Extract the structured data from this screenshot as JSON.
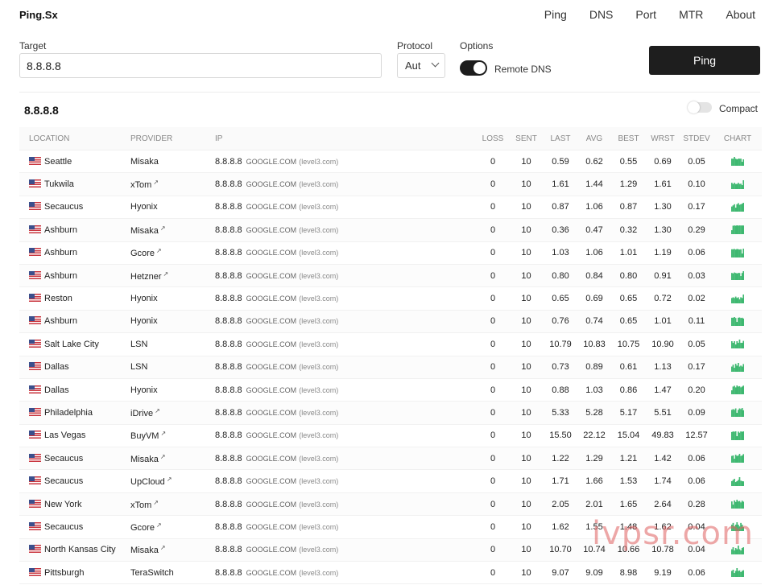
{
  "app": {
    "brand": "Ping.Sx"
  },
  "nav": [
    "Ping",
    "DNS",
    "Port",
    "MTR",
    "About"
  ],
  "form": {
    "target_label": "Target",
    "target_value": "8.8.8.8",
    "protocol_label": "Protocol",
    "protocol_value": "Aut",
    "options_label": "Options",
    "remote_dns_label": "Remote DNS",
    "remote_dns_enabled": true,
    "ping_button": "Ping"
  },
  "result": {
    "title": "8.8.8.8",
    "compact_label": "Compact",
    "compact_enabled": false
  },
  "table": {
    "headers": [
      "LOCATION",
      "PROVIDER",
      "IP",
      "LOSS",
      "SENT",
      "LAST",
      "AVG",
      "BEST",
      "WRST",
      "STDEV",
      "CHART"
    ],
    "rows": [
      {
        "location": "Seattle",
        "provider": "Misaka",
        "ext": false,
        "ip": "8.8.8.8",
        "host": "GOOGLE.COM",
        "sub": "(level3.com)",
        "loss": "0",
        "sent": "10",
        "last": "0.59",
        "avg": "0.62",
        "best": "0.55",
        "wrst": "0.69",
        "stdev": "0.05",
        "chart": [
          0.6,
          0.6,
          0.55,
          0.6,
          0.62,
          0.6,
          0.6,
          0.6,
          0.69,
          0.62
        ]
      },
      {
        "location": "Tukwila",
        "provider": "xTom",
        "ext": true,
        "ip": "8.8.8.8",
        "host": "GOOGLE.COM",
        "sub": "(level3.com)",
        "loss": "0",
        "sent": "10",
        "last": "1.61",
        "avg": "1.44",
        "best": "1.29",
        "wrst": "1.61",
        "stdev": "0.10",
        "chart": [
          1.4,
          1.45,
          1.4,
          1.45,
          1.45,
          1.4,
          1.45,
          1.44,
          1.5,
          1.29
        ]
      },
      {
        "location": "Secaucus",
        "provider": "Hyonix",
        "ext": false,
        "ip": "8.8.8.8",
        "host": "GOOGLE.COM",
        "sub": "(level3.com)",
        "loss": "0",
        "sent": "10",
        "last": "0.87",
        "avg": "1.06",
        "best": "0.87",
        "wrst": "1.30",
        "stdev": "0.17",
        "chart": [
          1.2,
          1.1,
          1.0,
          1.3,
          1.0,
          0.9,
          1.05,
          1.0,
          0.95,
          0.87
        ]
      },
      {
        "location": "Ashburn",
        "provider": "Misaka",
        "ext": true,
        "ip": "8.8.8.8",
        "host": "GOOGLE.COM",
        "sub": "(level3.com)",
        "loss": "0",
        "sent": "10",
        "last": "0.36",
        "avg": "0.47",
        "best": "0.32",
        "wrst": "1.30",
        "stdev": "0.29",
        "chart": [
          1.3,
          0.4,
          0.35,
          0.4,
          0.32,
          0.38,
          0.34,
          0.36,
          0.35,
          0.36
        ]
      },
      {
        "location": "Ashburn",
        "provider": "Gcore",
        "ext": true,
        "ip": "8.8.8.8",
        "host": "GOOGLE.COM",
        "sub": "(level3.com)",
        "loss": "0",
        "sent": "10",
        "last": "1.03",
        "avg": "1.06",
        "best": "1.01",
        "wrst": "1.19",
        "stdev": "0.06",
        "chart": [
          1.05,
          1.05,
          1.04,
          1.06,
          1.04,
          1.05,
          1.06,
          1.05,
          1.19,
          1.03
        ]
      },
      {
        "location": "Ashburn",
        "provider": "Hetzner",
        "ext": true,
        "ip": "8.8.8.8",
        "host": "GOOGLE.COM",
        "sub": "(level3.com)",
        "loss": "0",
        "sent": "10",
        "last": "0.80",
        "avg": "0.84",
        "best": "0.80",
        "wrst": "0.91",
        "stdev": "0.03",
        "chart": [
          0.84,
          0.85,
          0.83,
          0.84,
          0.85,
          0.84,
          0.84,
          0.91,
          0.84,
          0.8
        ]
      },
      {
        "location": "Reston",
        "provider": "Hyonix",
        "ext": false,
        "ip": "8.8.8.8",
        "host": "GOOGLE.COM",
        "sub": "(level3.com)",
        "loss": "0",
        "sent": "10",
        "last": "0.65",
        "avg": "0.69",
        "best": "0.65",
        "wrst": "0.72",
        "stdev": "0.02",
        "chart": [
          0.7,
          0.69,
          0.7,
          0.68,
          0.7,
          0.69,
          0.72,
          0.69,
          0.7,
          0.65
        ]
      },
      {
        "location": "Ashburn",
        "provider": "Hyonix",
        "ext": false,
        "ip": "8.8.8.8",
        "host": "GOOGLE.COM",
        "sub": "(level3.com)",
        "loss": "0",
        "sent": "10",
        "last": "0.76",
        "avg": "0.74",
        "best": "0.65",
        "wrst": "1.01",
        "stdev": "0.11",
        "chart": [
          0.7,
          0.7,
          0.65,
          0.72,
          1.01,
          0.7,
          0.68,
          0.72,
          0.7,
          0.76
        ]
      },
      {
        "location": "Salt Lake City",
        "provider": "LSN",
        "ext": false,
        "ip": "8.8.8.8",
        "host": "GOOGLE.COM",
        "sub": "(level3.com)",
        "loss": "0",
        "sent": "10",
        "last": "10.79",
        "avg": "10.83",
        "best": "10.75",
        "wrst": "10.90",
        "stdev": "0.05",
        "chart": [
          10.8,
          10.85,
          10.8,
          10.9,
          10.8,
          10.85,
          10.75,
          10.85,
          10.85,
          10.79
        ]
      },
      {
        "location": "Dallas",
        "provider": "LSN",
        "ext": false,
        "ip": "8.8.8.8",
        "host": "GOOGLE.COM",
        "sub": "(level3.com)",
        "loss": "0",
        "sent": "10",
        "last": "0.73",
        "avg": "0.89",
        "best": "0.61",
        "wrst": "1.13",
        "stdev": "0.17",
        "chart": [
          1.0,
          0.8,
          1.13,
          0.7,
          0.9,
          0.61,
          1.0,
          0.9,
          1.0,
          0.73
        ]
      },
      {
        "location": "Dallas",
        "provider": "Hyonix",
        "ext": false,
        "ip": "8.8.8.8",
        "host": "GOOGLE.COM",
        "sub": "(level3.com)",
        "loss": "0",
        "sent": "10",
        "last": "0.88",
        "avg": "1.03",
        "best": "0.86",
        "wrst": "1.47",
        "stdev": "0.20",
        "chart": [
          1.47,
          1.0,
          0.9,
          1.1,
          0.86,
          1.0,
          0.95,
          1.1,
          1.0,
          0.88
        ]
      },
      {
        "location": "Philadelphia",
        "provider": "iDrive",
        "ext": true,
        "ip": "8.8.8.8",
        "host": "GOOGLE.COM",
        "sub": "(level3.com)",
        "loss": "0",
        "sent": "10",
        "last": "5.33",
        "avg": "5.28",
        "best": "5.17",
        "wrst": "5.51",
        "stdev": "0.09",
        "chart": [
          5.3,
          5.25,
          5.3,
          5.2,
          5.51,
          5.3,
          5.2,
          5.25,
          5.17,
          5.33
        ]
      },
      {
        "location": "Las Vegas",
        "provider": "BuyVM",
        "ext": true,
        "ip": "8.8.8.8",
        "host": "GOOGLE.COM",
        "sub": "(level3.com)",
        "loss": "0",
        "sent": "10",
        "last": "15.50",
        "avg": "22.12",
        "best": "15.04",
        "wrst": "49.83",
        "stdev": "12.57",
        "chart": [
          20,
          16,
          18,
          15.04,
          49.83,
          17,
          25,
          16,
          18,
          15.5
        ]
      },
      {
        "location": "Secaucus",
        "provider": "Misaka",
        "ext": true,
        "ip": "8.8.8.8",
        "host": "GOOGLE.COM",
        "sub": "(level3.com)",
        "loss": "0",
        "sent": "10",
        "last": "1.22",
        "avg": "1.29",
        "best": "1.21",
        "wrst": "1.42",
        "stdev": "0.06",
        "chart": [
          1.3,
          1.28,
          1.42,
          1.25,
          1.3,
          1.28,
          1.21,
          1.3,
          1.28,
          1.22
        ]
      },
      {
        "location": "Secaucus",
        "provider": "UpCloud",
        "ext": true,
        "ip": "8.8.8.8",
        "host": "GOOGLE.COM",
        "sub": "(level3.com)",
        "loss": "0",
        "sent": "10",
        "last": "1.71",
        "avg": "1.66",
        "best": "1.53",
        "wrst": "1.74",
        "stdev": "0.06",
        "chart": [
          1.7,
          1.65,
          1.6,
          1.74,
          1.7,
          1.65,
          1.53,
          1.68,
          1.7,
          1.71
        ]
      },
      {
        "location": "New York",
        "provider": "xTom",
        "ext": true,
        "ip": "8.8.8.8",
        "host": "GOOGLE.COM",
        "sub": "(level3.com)",
        "loss": "0",
        "sent": "10",
        "last": "2.05",
        "avg": "2.01",
        "best": "1.65",
        "wrst": "2.64",
        "stdev": "0.28",
        "chart": [
          2.0,
          2.64,
          1.8,
          2.1,
          1.65,
          2.0,
          1.9,
          2.2,
          1.85,
          2.05
        ]
      },
      {
        "location": "Secaucus",
        "provider": "Gcore",
        "ext": true,
        "ip": "8.8.8.8",
        "host": "GOOGLE.COM",
        "sub": "(level3.com)",
        "loss": "0",
        "sent": "10",
        "last": "1.62",
        "avg": "1.55",
        "best": "1.48",
        "wrst": "1.62",
        "stdev": "0.04",
        "chart": [
          1.55,
          1.5,
          1.6,
          1.55,
          1.48,
          1.55,
          1.6,
          1.5,
          1.55,
          1.62
        ]
      },
      {
        "location": "North Kansas City",
        "provider": "Misaka",
        "ext": true,
        "ip": "8.8.8.8",
        "host": "GOOGLE.COM",
        "sub": "(level3.com)",
        "loss": "0",
        "sent": "10",
        "last": "10.70",
        "avg": "10.74",
        "best": "10.66",
        "wrst": "10.78",
        "stdev": "0.04",
        "chart": [
          10.75,
          10.7,
          10.78,
          10.72,
          10.75,
          10.66,
          10.75,
          10.78,
          10.72,
          10.7
        ]
      },
      {
        "location": "Pittsburgh",
        "provider": "TeraSwitch",
        "ext": false,
        "ip": "8.8.8.8",
        "host": "GOOGLE.COM",
        "sub": "(level3.com)",
        "loss": "0",
        "sent": "10",
        "last": "9.07",
        "avg": "9.09",
        "best": "8.98",
        "wrst": "9.19",
        "stdev": "0.06",
        "chart": [
          9.1,
          9.05,
          9.19,
          9.1,
          8.98,
          9.1,
          9.08,
          9.15,
          9.1,
          9.07
        ]
      }
    ]
  },
  "colors": {
    "chart_bar": "#3fb871",
    "button_dark": "#1e1e1e"
  },
  "icons": {
    "external_link": "external-link-icon",
    "flag": "us-flag-icon",
    "chevron": "chevron-down-icon"
  },
  "watermark": "ivpsr.com"
}
